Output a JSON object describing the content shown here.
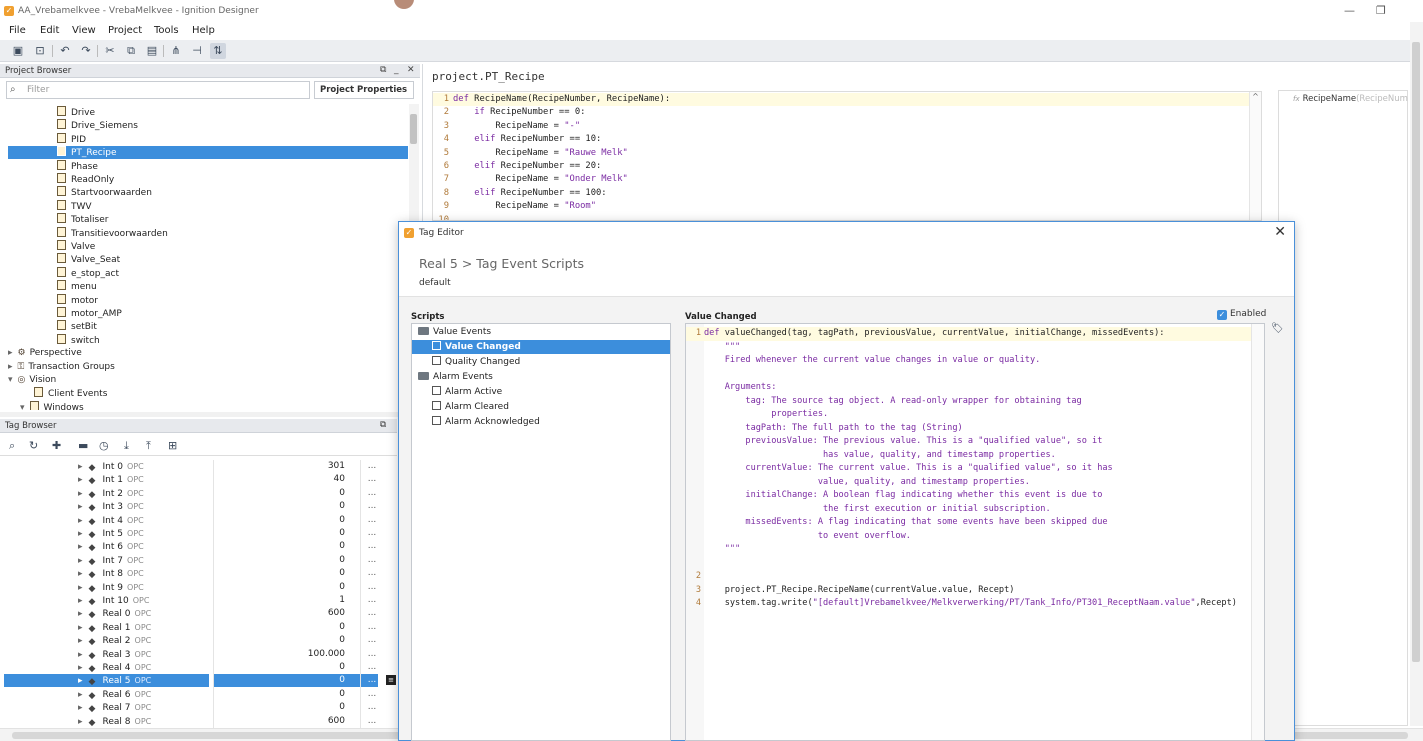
{
  "window": {
    "title": "AA_Vrebamelkvee - VrebaMelkvee - Ignition Designer",
    "minimize": "—",
    "restore": "❐"
  },
  "menu": [
    "File",
    "Edit",
    "View",
    "Project",
    "Tools",
    "Help"
  ],
  "toolbar_icons": [
    "save-icon",
    "save-all-icon",
    "undo-icon",
    "redo-icon",
    "cut-icon",
    "copy-icon",
    "paste-icon",
    "align-icon",
    "distribute-icon",
    "comm-icon"
  ],
  "project_browser": {
    "header": "Project Browser",
    "filter_placeholder": "Filter",
    "project_properties": "Project Properties",
    "scripts": [
      "Drive",
      "Drive_Siemens",
      "PID",
      "PT_Recipe",
      "Phase",
      "ReadOnly",
      "Startvoorwaarden",
      "TWV",
      "Totaliser",
      "Transitievoorwaarden",
      "Valve",
      "Valve_Seat",
      "e_stop_act",
      "menu",
      "motor",
      "motor_AMP",
      "setBit",
      "switch"
    ],
    "selected_script": "PT_Recipe",
    "sections": [
      {
        "label": "Perspective",
        "expanded": false
      },
      {
        "label": "Transaction Groups",
        "expanded": false
      },
      {
        "label": "Vision",
        "expanded": true
      }
    ],
    "vision_children": [
      "Client Events",
      "Windows"
    ]
  },
  "tag_browser": {
    "header": "Tag Browser",
    "tags": [
      {
        "name": "Int 0",
        "type": "OPC",
        "value": "301"
      },
      {
        "name": "Int 1",
        "type": "OPC",
        "value": "40"
      },
      {
        "name": "Int 2",
        "type": "OPC",
        "value": "0"
      },
      {
        "name": "Int 3",
        "type": "OPC",
        "value": "0"
      },
      {
        "name": "Int 4",
        "type": "OPC",
        "value": "0"
      },
      {
        "name": "Int 5",
        "type": "OPC",
        "value": "0"
      },
      {
        "name": "Int 6",
        "type": "OPC",
        "value": "0"
      },
      {
        "name": "Int 7",
        "type": "OPC",
        "value": "0"
      },
      {
        "name": "Int 8",
        "type": "OPC",
        "value": "0"
      },
      {
        "name": "Int 9",
        "type": "OPC",
        "value": "0"
      },
      {
        "name": "Int 10",
        "type": "OPC",
        "value": "1"
      },
      {
        "name": "Real 0",
        "type": "OPC",
        "value": "600"
      },
      {
        "name": "Real 1",
        "type": "OPC",
        "value": "0"
      },
      {
        "name": "Real 2",
        "type": "OPC",
        "value": "0"
      },
      {
        "name": "Real 3",
        "type": "OPC",
        "value": "100.000"
      },
      {
        "name": "Real 4",
        "type": "OPC",
        "value": "0"
      },
      {
        "name": "Real 5",
        "type": "OPC",
        "value": "0"
      },
      {
        "name": "Real 6",
        "type": "OPC",
        "value": "0"
      },
      {
        "name": "Real 7",
        "type": "OPC",
        "value": "0"
      },
      {
        "name": "Real 8",
        "type": "OPC",
        "value": "600"
      }
    ],
    "selected_tag": "Real 5",
    "more": "..."
  },
  "script_editor": {
    "title": "project.PT_Recipe",
    "lines": [
      {
        "n": "1",
        "code": "def RecipeName(RecipeNumber, RecipeName):"
      },
      {
        "n": "2",
        "code": "    if RecipeNumber == 0:"
      },
      {
        "n": "3",
        "code": "        RecipeName = \"-\""
      },
      {
        "n": "4",
        "code": "    elif RecipeNumber == 10:"
      },
      {
        "n": "5",
        "code": "        RecipeName = \"Rauwe Melk\""
      },
      {
        "n": "6",
        "code": "    elif RecipeNumber == 20:"
      },
      {
        "n": "7",
        "code": "        RecipeName = \"Onder Melk\""
      },
      {
        "n": "8",
        "code": "    elif RecipeNumber == 100:"
      },
      {
        "n": "9",
        "code": "        RecipeName = \"Room\""
      },
      {
        "n": "10",
        "code": ""
      }
    ],
    "function_list": {
      "name": "RecipeName",
      "args": "(RecipeNum"
    }
  },
  "tag_editor": {
    "title": "Tag Editor",
    "close": "✕",
    "breadcrumb": "Real 5 > Tag Event Scripts",
    "provider": "default",
    "scripts_label": "Scripts",
    "tree": [
      {
        "label": "Value Events",
        "kind": "folder"
      },
      {
        "label": "Value Changed",
        "kind": "event",
        "selected": true
      },
      {
        "label": "Quality Changed",
        "kind": "event"
      },
      {
        "label": "Alarm Events",
        "kind": "folder"
      },
      {
        "label": "Alarm Active",
        "kind": "event"
      },
      {
        "label": "Alarm Cleared",
        "kind": "event"
      },
      {
        "label": "Alarm Acknowledged",
        "kind": "event"
      }
    ],
    "section_label": "Value Changed",
    "enabled_label": "Enabled",
    "enabled": true,
    "code": [
      {
        "n": "1",
        "code": "def valueChanged(tag, tagPath, previousValue, currentValue, initialChange, missedEvents):",
        "kind": "def"
      },
      {
        "n": "",
        "code": "    \"\"\"",
        "kind": "doc"
      },
      {
        "n": "",
        "code": "    Fired whenever the current value changes in value or quality.",
        "kind": "doc"
      },
      {
        "n": "",
        "code": "",
        "kind": "doc"
      },
      {
        "n": "",
        "code": "    Arguments:",
        "kind": "doc"
      },
      {
        "n": "",
        "code": "        tag: The source tag object. A read-only wrapper for obtaining tag",
        "kind": "doc"
      },
      {
        "n": "",
        "code": "             properties.",
        "kind": "doc"
      },
      {
        "n": "",
        "code": "        tagPath: The full path to the tag (String)",
        "kind": "doc"
      },
      {
        "n": "",
        "code": "        previousValue: The previous value. This is a \"qualified value\", so it",
        "kind": "doc"
      },
      {
        "n": "",
        "code": "                       has value, quality, and timestamp properties.",
        "kind": "doc"
      },
      {
        "n": "",
        "code": "        currentValue: The current value. This is a \"qualified value\", so it has",
        "kind": "doc"
      },
      {
        "n": "",
        "code": "                      value, quality, and timestamp properties.",
        "kind": "doc"
      },
      {
        "n": "",
        "code": "        initialChange: A boolean flag indicating whether this event is due to",
        "kind": "doc"
      },
      {
        "n": "",
        "code": "                       the first execution or initial subscription.",
        "kind": "doc"
      },
      {
        "n": "",
        "code": "        missedEvents: A flag indicating that some events have been skipped due",
        "kind": "doc"
      },
      {
        "n": "",
        "code": "                      to event overflow.",
        "kind": "doc"
      },
      {
        "n": "",
        "code": "    \"\"\"",
        "kind": "doc"
      },
      {
        "n": "",
        "code": "",
        "kind": "code"
      },
      {
        "n": "2",
        "code": "",
        "kind": "code"
      },
      {
        "n": "3",
        "code": "    project.PT_Recipe.RecipeName(currentValue.value, Recept)",
        "kind": "code"
      },
      {
        "n": "4",
        "code": "    system.tag.write(\"[default]Vrebamelkvee/Melkverwerking/PT/Tank_Info/PT301_ReceptNaam.value\",Recept)",
        "kind": "code"
      }
    ]
  }
}
